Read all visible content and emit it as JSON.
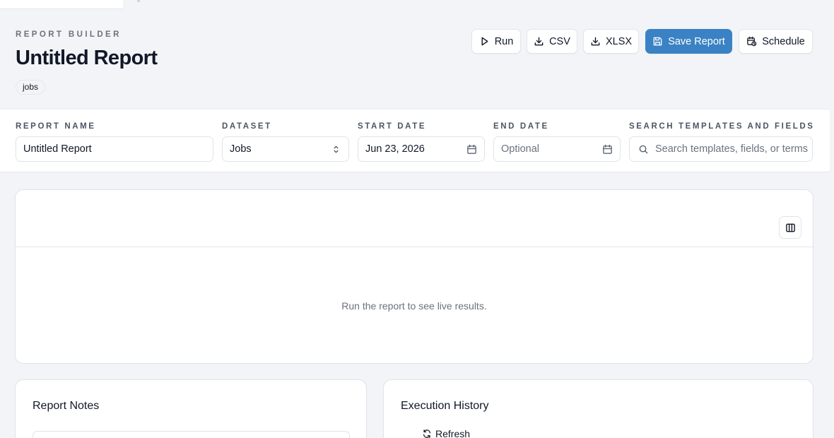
{
  "header": {
    "eyebrow": "REPORT BUILDER",
    "title": "Untitled Report",
    "tag": "jobs"
  },
  "toolbar": {
    "run_label": "Run",
    "csv_label": "CSV",
    "xlsx_label": "XLSX",
    "save_label": "Save Report",
    "schedule_label": "Schedule",
    "primary_color": "#3b82c4"
  },
  "filters": {
    "report_name": {
      "label": "REPORT NAME",
      "value": "Untitled Report"
    },
    "dataset": {
      "label": "DATASET",
      "value": "Jobs"
    },
    "start_date": {
      "label": "START DATE",
      "value": "Jun 23, 2026"
    },
    "end_date": {
      "label": "END DATE",
      "placeholder": "Optional"
    },
    "search": {
      "label": "SEARCH TEMPLATES AND FIELDS",
      "placeholder": "Search templates, fields, or terms"
    }
  },
  "results": {
    "empty_message": "Run the report to see live results."
  },
  "notes": {
    "title": "Report Notes"
  },
  "history": {
    "title": "Execution History",
    "refresh_label": "Refresh"
  },
  "icons": [
    "play-icon",
    "download-icon",
    "save-icon",
    "calendar-clock-icon",
    "chevron-updown-icon",
    "calendar-icon",
    "search-icon",
    "columns-icon",
    "refresh-icon"
  ]
}
